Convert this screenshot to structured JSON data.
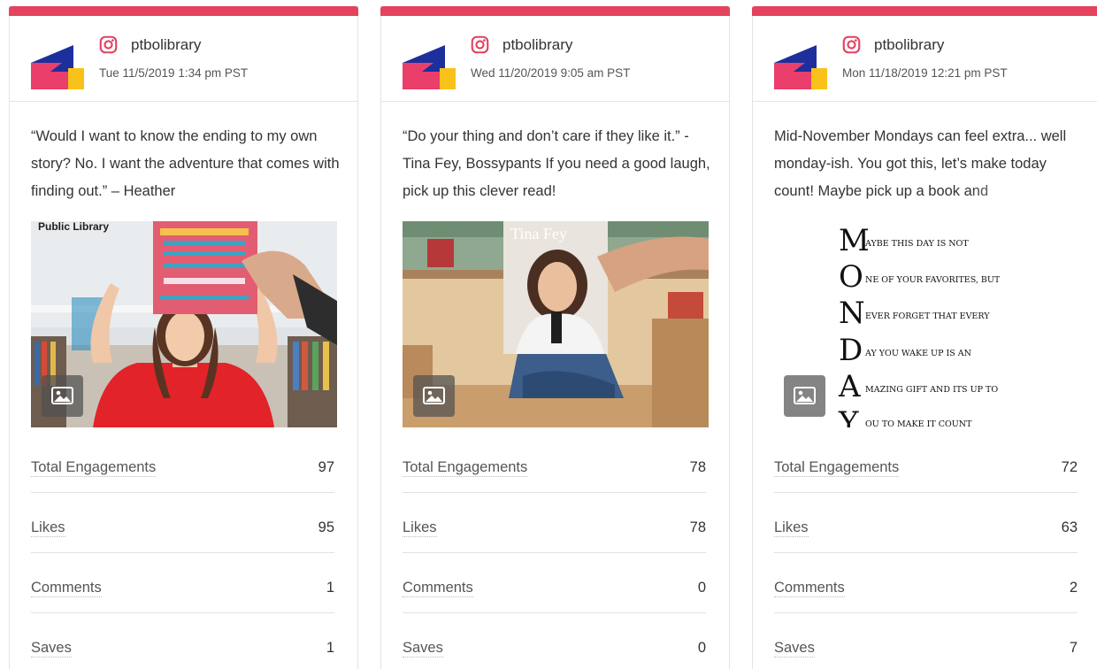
{
  "colors": {
    "accent": "#e3435e",
    "logo_pink": "#ea3e6b",
    "logo_navy": "#1d2f9c",
    "logo_yellow": "#f9c21b",
    "instagram_pink": "#e4405f"
  },
  "metric_labels": {
    "total": "Total Engagements",
    "likes": "Likes",
    "comments": "Comments",
    "saves": "Saves"
  },
  "cards": [
    {
      "profile": "ptbolibrary",
      "platform_icon": "instagram-icon",
      "timestamp": "Tue 11/5/2019 1:34 pm PST",
      "caption": "“Would I want to know the ending to my own story? No. I want the adventure that comes with finding out.” – Heather",
      "image_text": "Public Library",
      "media_badge_icon": "image-icon",
      "metrics": {
        "total": "97",
        "likes": "95",
        "comments": "1",
        "saves": "1"
      }
    },
    {
      "profile": "ptbolibrary",
      "platform_icon": "instagram-icon",
      "timestamp": "Wed 11/20/2019 9:05 am PST",
      "caption": "“Do your thing and don’t care if they like it.” - Tina Fey, Bossypants If you need a good laugh, pick up this clever read!",
      "image_text": "Tina Fey",
      "media_badge_icon": "image-icon",
      "metrics": {
        "total": "78",
        "likes": "78",
        "comments": "0",
        "saves": "0"
      }
    },
    {
      "profile": "ptbolibrary",
      "platform_icon": "instagram-icon",
      "timestamp": "Mon 11/18/2019 12:21 pm PST",
      "caption": "Mid-November Mondays can feel extra... well monday-ish. You got this, let’s make today count! Maybe pick up a book and",
      "media_badge_icon": "image-icon",
      "monday_lines": [
        {
          "letter": "M",
          "text": "AYBE THIS DAY IS NOT"
        },
        {
          "letter": "O",
          "text": "NE OF YOUR FAVORITES, BUT"
        },
        {
          "letter": "N",
          "text": "EVER FORGET THAT EVERY"
        },
        {
          "letter": "D",
          "text": "AY YOU WAKE UP IS AN"
        },
        {
          "letter": "A",
          "text": "MAZING GIFT AND ITS UP TO"
        },
        {
          "letter": "Y",
          "text": "OU TO MAKE IT COUNT"
        }
      ],
      "metrics": {
        "total": "72",
        "likes": "63",
        "comments": "2",
        "saves": "7"
      }
    }
  ]
}
